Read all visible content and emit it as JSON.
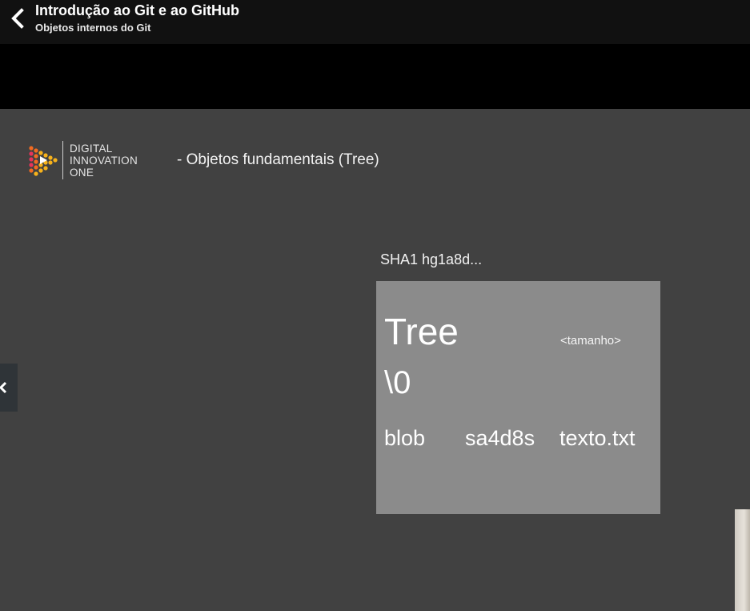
{
  "header": {
    "course_title": "Introdução ao Git e ao GitHub",
    "lesson_title": "Objetos internos do Git",
    "back_icon": "chevron-left-icon"
  },
  "slide": {
    "logo": {
      "lines": [
        "DIGITAL",
        "INNOVATION",
        "ONE"
      ],
      "accent_colors": [
        "#f7b21b",
        "#f26b21",
        "#e8345a"
      ]
    },
    "heading": "- Objetos fundamentais (Tree)",
    "sha_label": "SHA1 hg1a8d...",
    "tree_box": {
      "type_word": "Tree",
      "size_tag": "<tamanho>",
      "null_char": "\\0",
      "entry": {
        "kind": "blob",
        "hash": "sa4d8s",
        "filename": "texto.txt"
      }
    }
  },
  "side_nav": {
    "icon": "chevron-left-icon"
  },
  "colors": {
    "topbar": "#111111",
    "slide_bg": "#414141",
    "tree_box_bg": "#8b8b8b"
  }
}
